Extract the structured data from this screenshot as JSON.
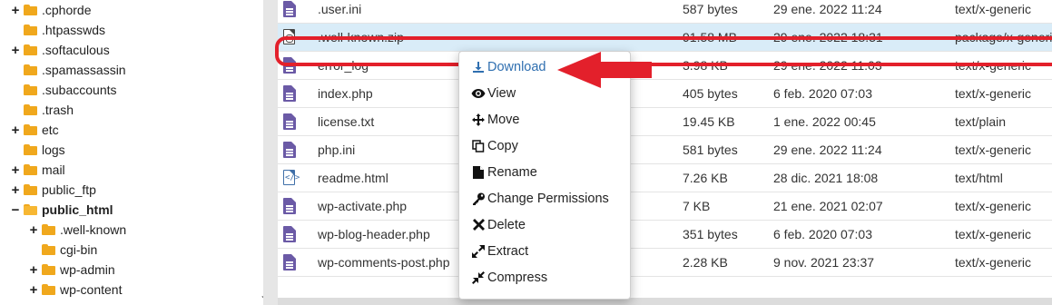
{
  "tree": {
    "items": [
      {
        "label": ".cphorde",
        "toggle": "+",
        "indent": 0,
        "bold": false
      },
      {
        "label": ".htpasswds",
        "toggle": "",
        "indent": 0,
        "bold": false
      },
      {
        "label": ".softaculous",
        "toggle": "+",
        "indent": 0,
        "bold": false
      },
      {
        "label": ".spamassassin",
        "toggle": "",
        "indent": 0,
        "bold": false
      },
      {
        "label": ".subaccounts",
        "toggle": "",
        "indent": 0,
        "bold": false
      },
      {
        "label": ".trash",
        "toggle": "",
        "indent": 0,
        "bold": false
      },
      {
        "label": "etc",
        "toggle": "+",
        "indent": 0,
        "bold": false
      },
      {
        "label": "logs",
        "toggle": "",
        "indent": 0,
        "bold": false
      },
      {
        "label": "mail",
        "toggle": "+",
        "indent": 0,
        "bold": false
      },
      {
        "label": "public_ftp",
        "toggle": "+",
        "indent": 0,
        "bold": false
      },
      {
        "label": "public_html",
        "toggle": "−",
        "indent": 0,
        "bold": true
      },
      {
        "label": ".well-known",
        "toggle": "+",
        "indent": 1,
        "bold": false
      },
      {
        "label": "cgi-bin",
        "toggle": "",
        "indent": 1,
        "bold": false
      },
      {
        "label": "wp-admin",
        "toggle": "+",
        "indent": 1,
        "bold": false
      },
      {
        "label": "wp-content",
        "toggle": "+",
        "indent": 1,
        "bold": false
      }
    ]
  },
  "files": [
    {
      "name": ".user.ini",
      "size": "587 bytes",
      "date": "29 ene. 2022 11:24",
      "type": "text/x-generic",
      "icon": "text",
      "selected": false
    },
    {
      "name": ".well-known.zip",
      "size": "91.58 MB",
      "date": "29 ene. 2022 18:31",
      "type": "package/x-generic",
      "icon": "zip",
      "selected": true
    },
    {
      "name": "error_log",
      "size": "3.98 KB",
      "date": "29 ene. 2022 11:03",
      "type": "text/x-generic",
      "icon": "text",
      "selected": false
    },
    {
      "name": "index.php",
      "size": "405 bytes",
      "date": "6 feb. 2020 07:03",
      "type": "text/x-generic",
      "icon": "text",
      "selected": false
    },
    {
      "name": "license.txt",
      "size": "19.45 KB",
      "date": "1 ene. 2022 00:45",
      "type": "text/plain",
      "icon": "text",
      "selected": false
    },
    {
      "name": "php.ini",
      "size": "581 bytes",
      "date": "29 ene. 2022 11:24",
      "type": "text/x-generic",
      "icon": "text",
      "selected": false
    },
    {
      "name": "readme.html",
      "size": "7.26 KB",
      "date": "28 dic. 2021 18:08",
      "type": "text/html",
      "icon": "html",
      "selected": false
    },
    {
      "name": "wp-activate.php",
      "size": "7 KB",
      "date": "21 ene. 2021 02:07",
      "type": "text/x-generic",
      "icon": "text",
      "selected": false
    },
    {
      "name": "wp-blog-header.php",
      "size": "351 bytes",
      "date": "6 feb. 2020 07:03",
      "type": "text/x-generic",
      "icon": "text",
      "selected": false
    },
    {
      "name": "wp-comments-post.php",
      "size": "2.28 KB",
      "date": "9 nov. 2021 23:37",
      "type": "text/x-generic",
      "icon": "text",
      "selected": false
    }
  ],
  "context_menu": {
    "items": [
      {
        "label": "Download",
        "icon": "download-icon"
      },
      {
        "label": "View",
        "icon": "eye-icon"
      },
      {
        "label": "Move",
        "icon": "move-icon"
      },
      {
        "label": "Copy",
        "icon": "copy-icon"
      },
      {
        "label": "Rename",
        "icon": "file-icon"
      },
      {
        "label": "Change Permissions",
        "icon": "key-icon"
      },
      {
        "label": "Delete",
        "icon": "close-icon"
      },
      {
        "label": "Extract",
        "icon": "expand-icon"
      },
      {
        "label": "Compress",
        "icon": "compress-icon"
      }
    ]
  },
  "colors": {
    "highlight_border": "#e3202b",
    "selected_row": "#d9ecf8",
    "folder": "#f0a81d",
    "link_blue": "#2f6fb0"
  }
}
